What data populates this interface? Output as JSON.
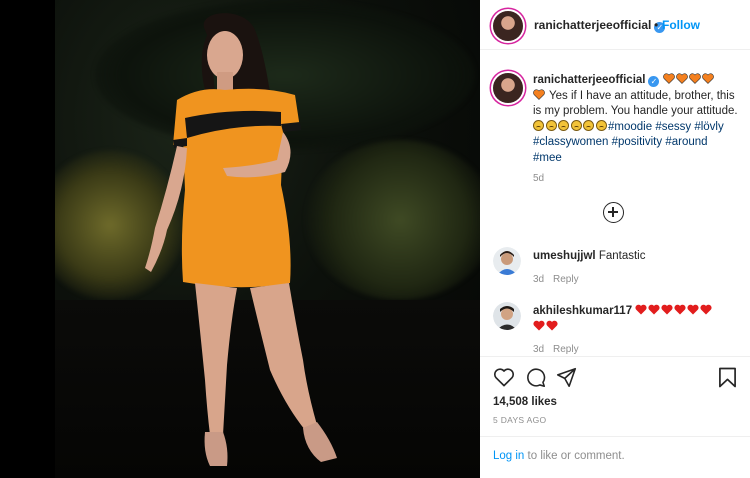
{
  "post": {
    "author": "ranichatterjeeofficial",
    "separator": "•",
    "follow_label": "Follow",
    "caption_text": " Yes if I have an attitude, brother, this is my problem. You handle your attitude. ",
    "hashtags": [
      "#moodie",
      "#sessy",
      "#lövly",
      "#classywomen",
      "#positivity",
      "#around",
      "#mee"
    ],
    "caption_time": "5d",
    "likes": "14,508 likes",
    "posted_ago": "5 DAYS AGO"
  },
  "comments": [
    {
      "user": "umeshujjwl",
      "text": "Fantastic",
      "time": "3d",
      "reply_label": "Reply"
    },
    {
      "user": "akhileshkumar117",
      "text": "",
      "time": "3d",
      "reply_label": "Reply"
    }
  ],
  "footer": {
    "login_label": "Log in",
    "login_suffix": " to like or comment."
  },
  "colors": {
    "link_blue": "#0095f6",
    "hashtag_blue": "#00376b",
    "muted": "#8e8e8e",
    "dress_orange": "#f0941f",
    "heart_orange": "#f4801f",
    "heart_red": "#e21d1d"
  },
  "icons": [
    "verified-badge-icon",
    "load-more-comments-icon",
    "like-heart-icon",
    "comment-icon",
    "share-icon",
    "save-bookmark-icon"
  ]
}
